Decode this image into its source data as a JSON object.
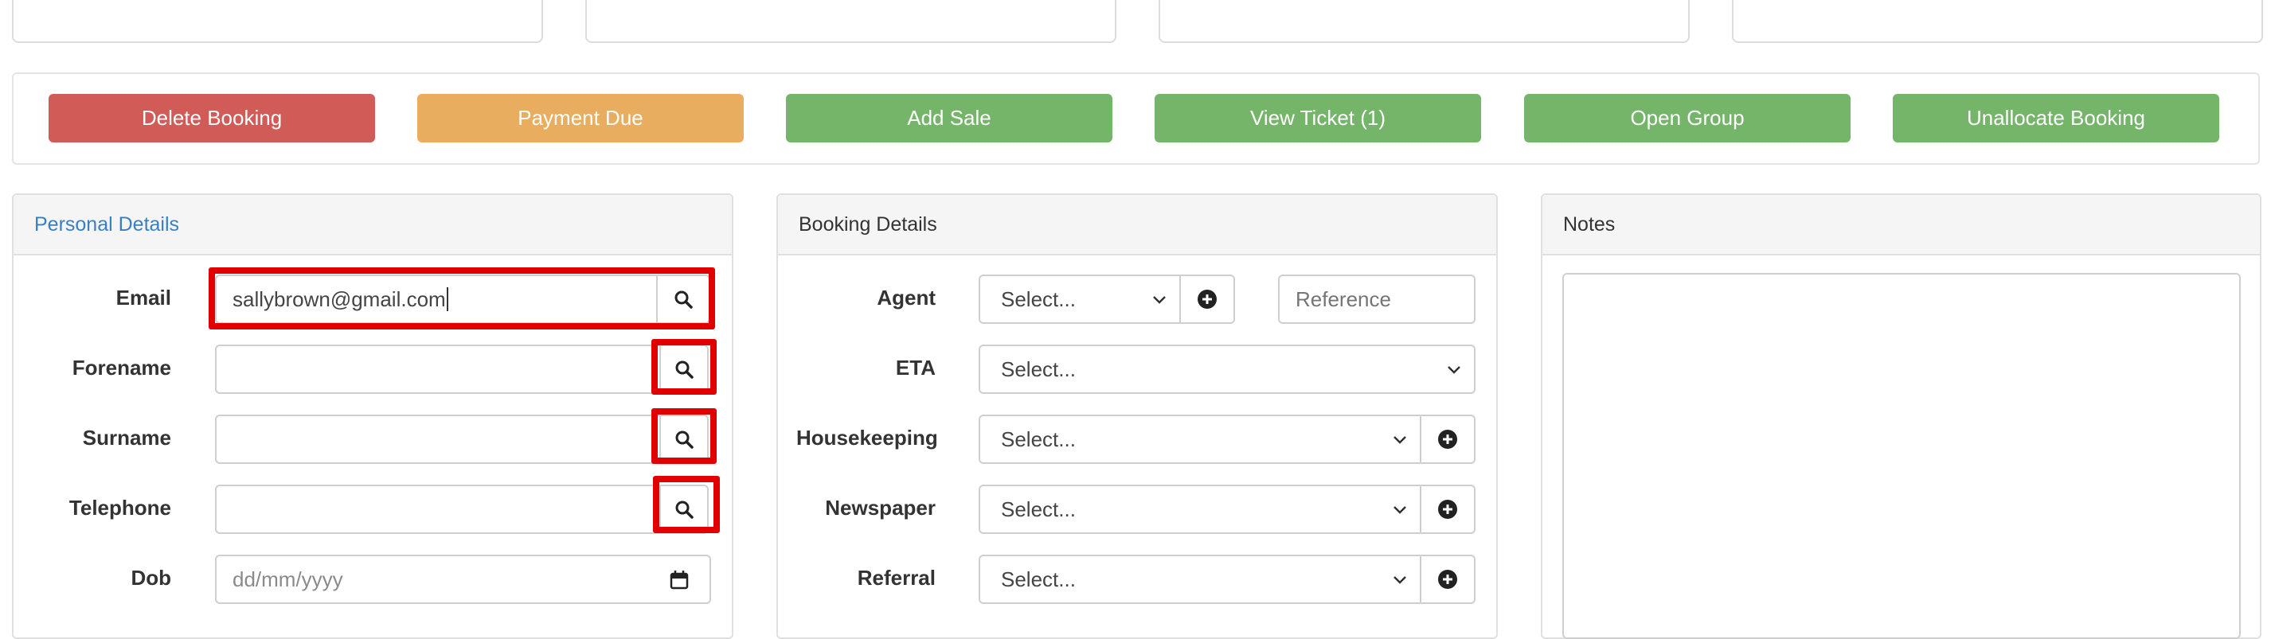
{
  "actions": {
    "delete": "Delete Booking",
    "payment": "Payment Due",
    "add_sale": "Add Sale",
    "view_ticket": "View Ticket (1)",
    "open_group": "Open Group",
    "unallocate": "Unallocate Booking"
  },
  "personal": {
    "title": "Personal Details",
    "email_label": "Email",
    "email_value": "sallybrown@gmail.com",
    "forename_label": "Forename",
    "surname_label": "Surname",
    "telephone_label": "Telephone",
    "dob_label": "Dob",
    "dob_placeholder": "dd/mm/yyyy"
  },
  "booking": {
    "title": "Booking Details",
    "agent_label": "Agent",
    "agent_value": "Select...",
    "reference_placeholder": "Reference",
    "eta_label": "ETA",
    "eta_value": "Select...",
    "housekeeping_label": "Housekeeping",
    "housekeeping_value": "Select...",
    "newspaper_label": "Newspaper",
    "newspaper_value": "Select...",
    "referral_label": "Referral",
    "referral_value": "Select..."
  },
  "notes": {
    "title": "Notes"
  },
  "colors": {
    "danger": "#d05b57",
    "warning": "#e9ad5f",
    "success": "#75b56a",
    "highlight": "#e00000",
    "link": "#3a7fc1"
  },
  "icons": [
    "search-icon",
    "plus-circle-icon",
    "chevron-down-icon",
    "calendar-icon"
  ]
}
